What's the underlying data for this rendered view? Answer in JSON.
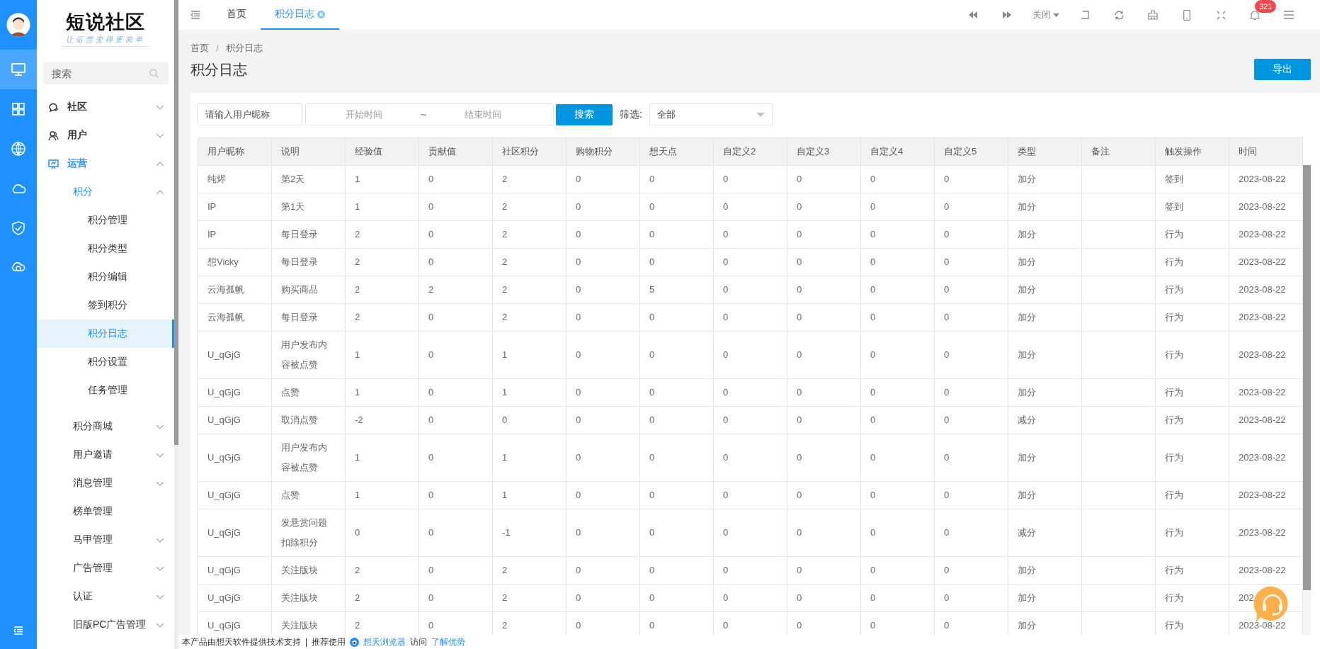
{
  "rail": {
    "items": [
      {
        "selected": true
      },
      {
        "selected": false
      },
      {
        "selected": false
      },
      {
        "selected": false
      },
      {
        "selected": false
      },
      {
        "selected": false
      }
    ]
  },
  "sidebar": {
    "logo": {
      "title": "短说社区",
      "slogan": "让运营变得更简单"
    },
    "search": {
      "placeholder": "搜索"
    },
    "items": [
      {
        "label": "社区",
        "expanded": false
      },
      {
        "label": "用户",
        "expanded": false
      },
      {
        "label": "运营",
        "expanded": true,
        "children": [
          {
            "label": "积分",
            "expanded": true,
            "children": [
              {
                "label": "积分管理",
                "selected": false
              },
              {
                "label": "积分类型",
                "selected": false
              },
              {
                "label": "积分编辑",
                "selected": false
              },
              {
                "label": "签到积分",
                "selected": false
              },
              {
                "label": "积分日志",
                "selected": true
              },
              {
                "label": "积分设置",
                "selected": false
              },
              {
                "label": "任务管理",
                "selected": false
              }
            ]
          },
          {
            "label": "积分商城",
            "expanded": false
          },
          {
            "label": "用户邀请",
            "expanded": false
          },
          {
            "label": "消息管理",
            "expanded": false
          },
          {
            "label": "榜单管理"
          },
          {
            "label": "马甲管理",
            "expanded": false
          },
          {
            "label": "广告管理",
            "expanded": false
          },
          {
            "label": "认证",
            "expanded": false
          },
          {
            "label": "旧版PC广告管理",
            "expanded": false
          }
        ]
      }
    ]
  },
  "tabs": [
    {
      "label": "首页",
      "selected": false
    },
    {
      "label": "积分日志",
      "selected": true,
      "closable": true
    }
  ],
  "toolbar": {
    "close_menu": "关闭",
    "notification_count": "321"
  },
  "breadcrumb": {
    "separator": "/",
    "items": [
      "首页",
      "积分日志"
    ]
  },
  "page_title": "积分日志",
  "export_button": "导出",
  "filters": {
    "nickname": {
      "placeholder": "请输入用户昵称"
    },
    "date_range": {
      "start_placeholder": "开始时间",
      "separator": "~",
      "end_placeholder": "结束时间"
    },
    "search_button": "搜索",
    "filter_label": "筛选:",
    "filter_select": {
      "value": "全部"
    }
  },
  "table": {
    "columns": [
      "用户昵称",
      "说明",
      "经验值",
      "贡献值",
      "社区积分",
      "购物积分",
      "想天点",
      "自定义2",
      "自定义3",
      "自定义4",
      "自定义5",
      "类型",
      "备注",
      "触发操作",
      "时间"
    ],
    "rows": [
      [
        "纯烬",
        "第2天",
        "1",
        "0",
        "2",
        "0",
        "0",
        "0",
        "0",
        "0",
        "0",
        "加分",
        null,
        "签到",
        "2023-08-22"
      ],
      [
        "IP",
        "第1天",
        "1",
        "0",
        "2",
        "0",
        "0",
        "0",
        "0",
        "0",
        "0",
        "加分",
        null,
        "签到",
        "2023-08-22"
      ],
      [
        "IP",
        "每日登录",
        "2",
        "0",
        "2",
        "0",
        "0",
        "0",
        "0",
        "0",
        "0",
        "加分",
        null,
        "行为",
        "2023-08-22"
      ],
      [
        "想Vicky",
        "每日登录",
        "2",
        "0",
        "2",
        "0",
        "0",
        "0",
        "0",
        "0",
        "0",
        "加分",
        null,
        "行为",
        "2023-08-22"
      ],
      [
        "云海孤帆",
        "购买商品",
        "2",
        "2",
        "2",
        "0",
        "5",
        "0",
        "0",
        "0",
        "0",
        "加分",
        null,
        "行为",
        "2023-08-22"
      ],
      [
        "云海孤帆",
        "每日登录",
        "2",
        "0",
        "2",
        "0",
        "0",
        "0",
        "0",
        "0",
        "0",
        "加分",
        null,
        "行为",
        "2023-08-22"
      ],
      [
        "U_qGjG",
        "用户发布内容被点赞",
        "1",
        "0",
        "1",
        "0",
        "0",
        "0",
        "0",
        "0",
        "0",
        "加分",
        null,
        "行为",
        "2023-08-22"
      ],
      [
        "U_qGjG",
        "点赞",
        "1",
        "0",
        "1",
        "0",
        "0",
        "0",
        "0",
        "0",
        "0",
        "加分",
        null,
        "行为",
        "2023-08-22"
      ],
      [
        "U_qGjG",
        "取消点赞",
        "-2",
        "0",
        "0",
        "0",
        "0",
        "0",
        "0",
        "0",
        "0",
        "减分",
        null,
        "行为",
        "2023-08-22"
      ],
      [
        "U_qGjG",
        "用户发布内容被点赞",
        "1",
        "0",
        "1",
        "0",
        "0",
        "0",
        "0",
        "0",
        "0",
        "加分",
        null,
        "行为",
        "2023-08-22"
      ],
      [
        "U_qGjG",
        "点赞",
        "1",
        "0",
        "1",
        "0",
        "0",
        "0",
        "0",
        "0",
        "0",
        "加分",
        null,
        "行为",
        "2023-08-22"
      ],
      [
        "U_qGjG",
        "发悬赏问题扣除积分",
        "0",
        "0",
        "-1",
        "0",
        "0",
        "0",
        "0",
        "0",
        "0",
        "减分",
        null,
        "行为",
        "2023-08-22"
      ],
      [
        "U_qGjG",
        "关注版块",
        "2",
        "0",
        "2",
        "0",
        "0",
        "0",
        "0",
        "0",
        "0",
        "加分",
        null,
        "行为",
        "2023-08-22"
      ],
      [
        "U_qGjG",
        "关注版块",
        "2",
        "0",
        "2",
        "0",
        "0",
        "0",
        "0",
        "0",
        "0",
        "加分",
        null,
        "行为",
        "202"
      ],
      [
        "U_qGjG",
        "关注版块",
        "2",
        "0",
        "2",
        "0",
        "0",
        "0",
        "0",
        "0",
        "0",
        "加分",
        null,
        "行为",
        "2023-08-22"
      ]
    ]
  },
  "footer": {
    "support": "本产品由想天软件提供技术支持",
    "separator": "|",
    "recommend": "推荐使用",
    "browser_link": "想天浏览器",
    "visit": "访问",
    "advantages_link": "了解优势"
  }
}
